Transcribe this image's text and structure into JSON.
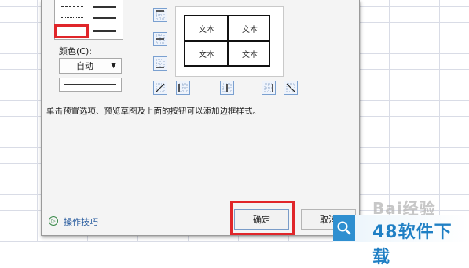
{
  "dialog": {
    "color_label": "颜色(C):",
    "color_value": "自动",
    "hint": "单击预置选项、预览草图及上面的按钮可以添加边框样式。",
    "tips_label": "操作技巧",
    "ok_label": "确定",
    "cancel_label": "取消"
  },
  "preview": {
    "cells": [
      "文本",
      "文本",
      "文本",
      "文本"
    ]
  },
  "watermark": {
    "baidu_text": "Bai经验",
    "site_text": "48软件下载"
  },
  "colors": {
    "highlight": "#e0262a",
    "button_border": "#7aa0d0",
    "watermark_blue": "#1f7fc4"
  },
  "icons": [
    "chevron-down-icon",
    "magnifier-icon",
    "tips-icon"
  ]
}
